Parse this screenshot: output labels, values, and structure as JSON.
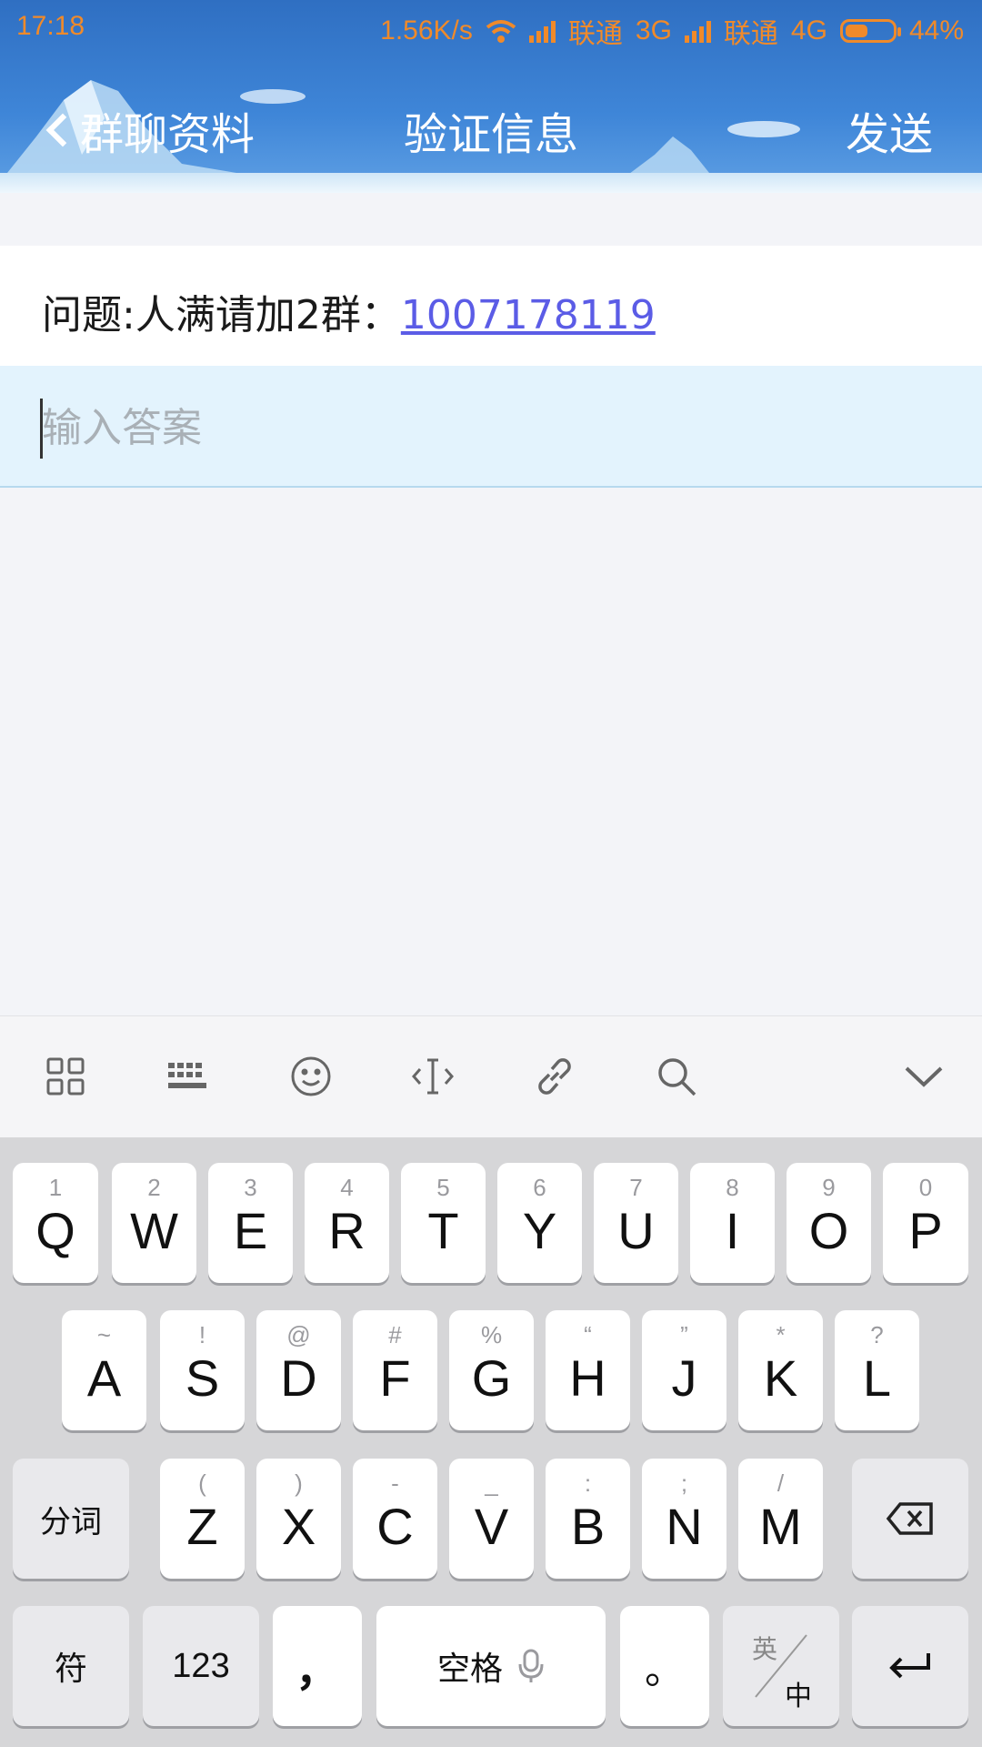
{
  "status_bar": {
    "time": "17:18",
    "net_speed": "1.56K/s",
    "carrier1": "联通",
    "net1": "3G",
    "carrier2": "联通",
    "net2": "4G",
    "battery": "44%",
    "color": "#f08a2a"
  },
  "title_bar": {
    "back_label": "群聊资料",
    "title": "验证信息",
    "send_label": "发送"
  },
  "question": {
    "label": "问题:人满请加2群：",
    "link": "1007178119"
  },
  "answer": {
    "placeholder": "输入答案",
    "value": ""
  },
  "toolbar": {
    "icons": [
      "grid-icon",
      "keyboard-icon",
      "emoji-icon",
      "cursor-icon",
      "link-icon",
      "search-icon",
      "collapse-icon"
    ]
  },
  "keyboard": {
    "row1": [
      {
        "key": "Q",
        "sub": "1"
      },
      {
        "key": "W",
        "sub": "2"
      },
      {
        "key": "E",
        "sub": "3"
      },
      {
        "key": "R",
        "sub": "4"
      },
      {
        "key": "T",
        "sub": "5"
      },
      {
        "key": "Y",
        "sub": "6"
      },
      {
        "key": "U",
        "sub": "7"
      },
      {
        "key": "I",
        "sub": "8"
      },
      {
        "key": "O",
        "sub": "9"
      },
      {
        "key": "P",
        "sub": "0"
      }
    ],
    "row2": [
      {
        "key": "A",
        "sub": "~"
      },
      {
        "key": "S",
        "sub": "!"
      },
      {
        "key": "D",
        "sub": "@"
      },
      {
        "key": "F",
        "sub": "#"
      },
      {
        "key": "G",
        "sub": "%"
      },
      {
        "key": "H",
        "sub": "“"
      },
      {
        "key": "J",
        "sub": "”"
      },
      {
        "key": "K",
        "sub": "*"
      },
      {
        "key": "L",
        "sub": "?"
      }
    ],
    "row3": [
      {
        "key": "Z",
        "sub": "("
      },
      {
        "key": "X",
        "sub": ")"
      },
      {
        "key": "C",
        "sub": "-"
      },
      {
        "key": "V",
        "sub": "_"
      },
      {
        "key": "B",
        "sub": ":"
      },
      {
        "key": "N",
        "sub": ";"
      },
      {
        "key": "M",
        "sub": "/"
      }
    ],
    "segment_label": "分词",
    "symbol_label": "符",
    "numbers_label": "123",
    "comma_label": "，",
    "space_label": "空格",
    "period_label": "。",
    "lang_en": "英",
    "lang_zh": "中"
  }
}
